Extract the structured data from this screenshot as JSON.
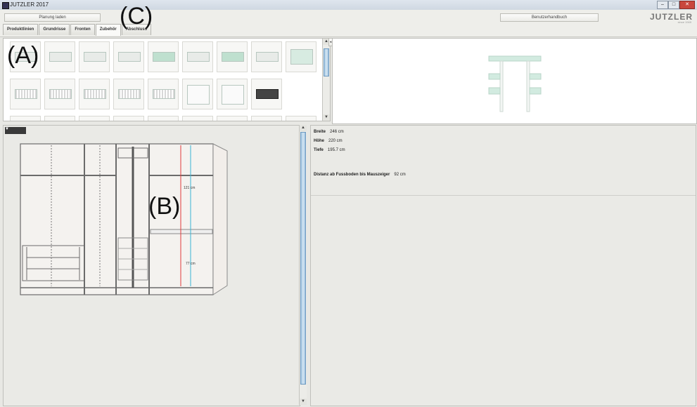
{
  "window": {
    "title": "JUTZLER 2017",
    "controls": [
      "–",
      "□",
      "✕"
    ]
  },
  "toolbar": {
    "load_button": "Planung laden",
    "manual_button": "Benutzerhandbuch",
    "logo": "JUTZLER",
    "logo_sub": "since 1949"
  },
  "tabs": [
    {
      "label": "Produktlinien",
      "active": false
    },
    {
      "label": "Grundrisse",
      "active": false
    },
    {
      "label": "Fronten",
      "active": false
    },
    {
      "label": "Zubehör",
      "active": true
    },
    {
      "label": "Abschluss",
      "active": false
    }
  ],
  "labels": {
    "a": "(A)",
    "b": "(B)",
    "c": "(C)"
  },
  "catalog": {
    "items": [
      "shelf-board-icon",
      "shelf-board-icon",
      "shelf-board-icon",
      "tray-icon",
      "tray-green-icon",
      "tray-icon",
      "tray-green-icon",
      "tray-icon",
      "drawer-box-icon",
      "wire-shelf-icon",
      "basket-icon",
      "basket-icon",
      "basket-icon",
      "wire-rack-icon",
      "cabinet-insert-icon",
      "cabinet-insert-icon",
      "dark-insert-icon"
    ]
  },
  "plan": {
    "dim_upper": "121 cm",
    "dim_lower": "77 cm"
  },
  "info": {
    "breite_label": "Breite",
    "breite_value": "246 cm",
    "hoehe_label": "Höhe",
    "hoehe_value": "220 cm",
    "tiefe_label": "Tiefe",
    "tiefe_value": "195.7 cm",
    "distanz_label": "Distanz ab Fussboden bis Mauszeiger",
    "distanz_value": "92 cm"
  },
  "colors": {
    "accent_green": "#b9dccb",
    "dim_red": "#e23b3b",
    "dim_cyan": "#38b4d4"
  }
}
